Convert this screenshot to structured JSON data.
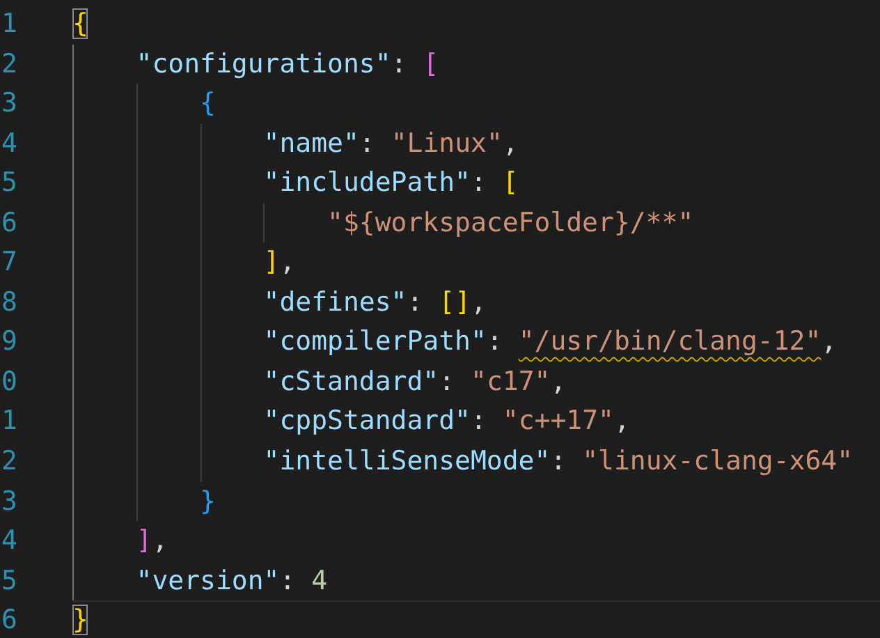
{
  "editor": {
    "lines": [
      {
        "number": "1",
        "current": false,
        "tokens": [
          {
            "kind": "open",
            "text": "{",
            "color": "#ffd700",
            "matched": true
          }
        ]
      },
      {
        "number": "2",
        "current": false,
        "tokens": [
          {
            "kind": "key",
            "text": "\"configurations\""
          },
          {
            "kind": "punct",
            "text": ": "
          },
          {
            "kind": "open",
            "text": "[",
            "color": "#da70d6",
            "matched": false
          }
        ]
      },
      {
        "number": "3",
        "current": false,
        "tokens": [
          {
            "kind": "open",
            "text": "{",
            "color": "#179fff",
            "matched": false
          }
        ]
      },
      {
        "number": "4",
        "current": false,
        "tokens": [
          {
            "kind": "key",
            "text": "\"name\""
          },
          {
            "kind": "punct",
            "text": ": "
          },
          {
            "kind": "string",
            "text": "\"Linux\"",
            "warning": false
          },
          {
            "kind": "punct",
            "text": ","
          }
        ]
      },
      {
        "number": "5",
        "current": false,
        "tokens": [
          {
            "kind": "key",
            "text": "\"includePath\""
          },
          {
            "kind": "punct",
            "text": ": "
          },
          {
            "kind": "open",
            "text": "[",
            "color": "#ffd700",
            "matched": false
          }
        ]
      },
      {
        "number": "6",
        "current": false,
        "tokens": [
          {
            "kind": "string",
            "text": "\"${workspaceFolder}/**\"",
            "warning": false
          }
        ]
      },
      {
        "number": "7",
        "current": false,
        "tokens": [
          {
            "kind": "close",
            "text": "]",
            "color": "#ffd700",
            "matched": false
          },
          {
            "kind": "punct",
            "text": ","
          }
        ]
      },
      {
        "number": "8",
        "current": false,
        "tokens": [
          {
            "kind": "key",
            "text": "\"defines\""
          },
          {
            "kind": "punct",
            "text": ": "
          },
          {
            "kind": "open",
            "text": "[",
            "color": "#ffd700",
            "matched": false
          },
          {
            "kind": "close",
            "text": "]",
            "color": "#ffd700",
            "matched": false
          },
          {
            "kind": "punct",
            "text": ","
          }
        ]
      },
      {
        "number": "9",
        "current": false,
        "tokens": [
          {
            "kind": "key",
            "text": "\"compilerPath\""
          },
          {
            "kind": "punct",
            "text": ": "
          },
          {
            "kind": "string",
            "text": "\"/usr/bin/clang-12\"",
            "warning": true
          },
          {
            "kind": "punct",
            "text": ","
          }
        ]
      },
      {
        "number": "0",
        "current": false,
        "tokens": [
          {
            "kind": "key",
            "text": "\"cStandard\""
          },
          {
            "kind": "punct",
            "text": ": "
          },
          {
            "kind": "string",
            "text": "\"c17\"",
            "warning": false
          },
          {
            "kind": "punct",
            "text": ","
          }
        ]
      },
      {
        "number": "1",
        "current": false,
        "tokens": [
          {
            "kind": "key",
            "text": "\"cppStandard\""
          },
          {
            "kind": "punct",
            "text": ": "
          },
          {
            "kind": "string",
            "text": "\"c++17\"",
            "warning": false
          },
          {
            "kind": "punct",
            "text": ","
          }
        ]
      },
      {
        "number": "2",
        "current": false,
        "tokens": [
          {
            "kind": "key",
            "text": "\"intelliSenseMode\""
          },
          {
            "kind": "punct",
            "text": ": "
          },
          {
            "kind": "string",
            "text": "\"linux-clang-x64\"",
            "warning": false
          }
        ]
      },
      {
        "number": "3",
        "current": false,
        "tokens": [
          {
            "kind": "close",
            "text": "}",
            "color": "#179fff",
            "matched": false
          }
        ]
      },
      {
        "number": "4",
        "current": false,
        "tokens": [
          {
            "kind": "close",
            "text": "]",
            "color": "#da70d6",
            "matched": false
          },
          {
            "kind": "punct",
            "text": ","
          }
        ]
      },
      {
        "number": "5",
        "current": false,
        "tokens": [
          {
            "kind": "key",
            "text": "\"version\""
          },
          {
            "kind": "punct",
            "text": ": "
          },
          {
            "kind": "number",
            "text": "4"
          }
        ]
      },
      {
        "number": "6",
        "current": true,
        "tokens": [
          {
            "kind": "close",
            "text": "}",
            "color": "#ffd700",
            "matched": true
          }
        ]
      }
    ]
  }
}
